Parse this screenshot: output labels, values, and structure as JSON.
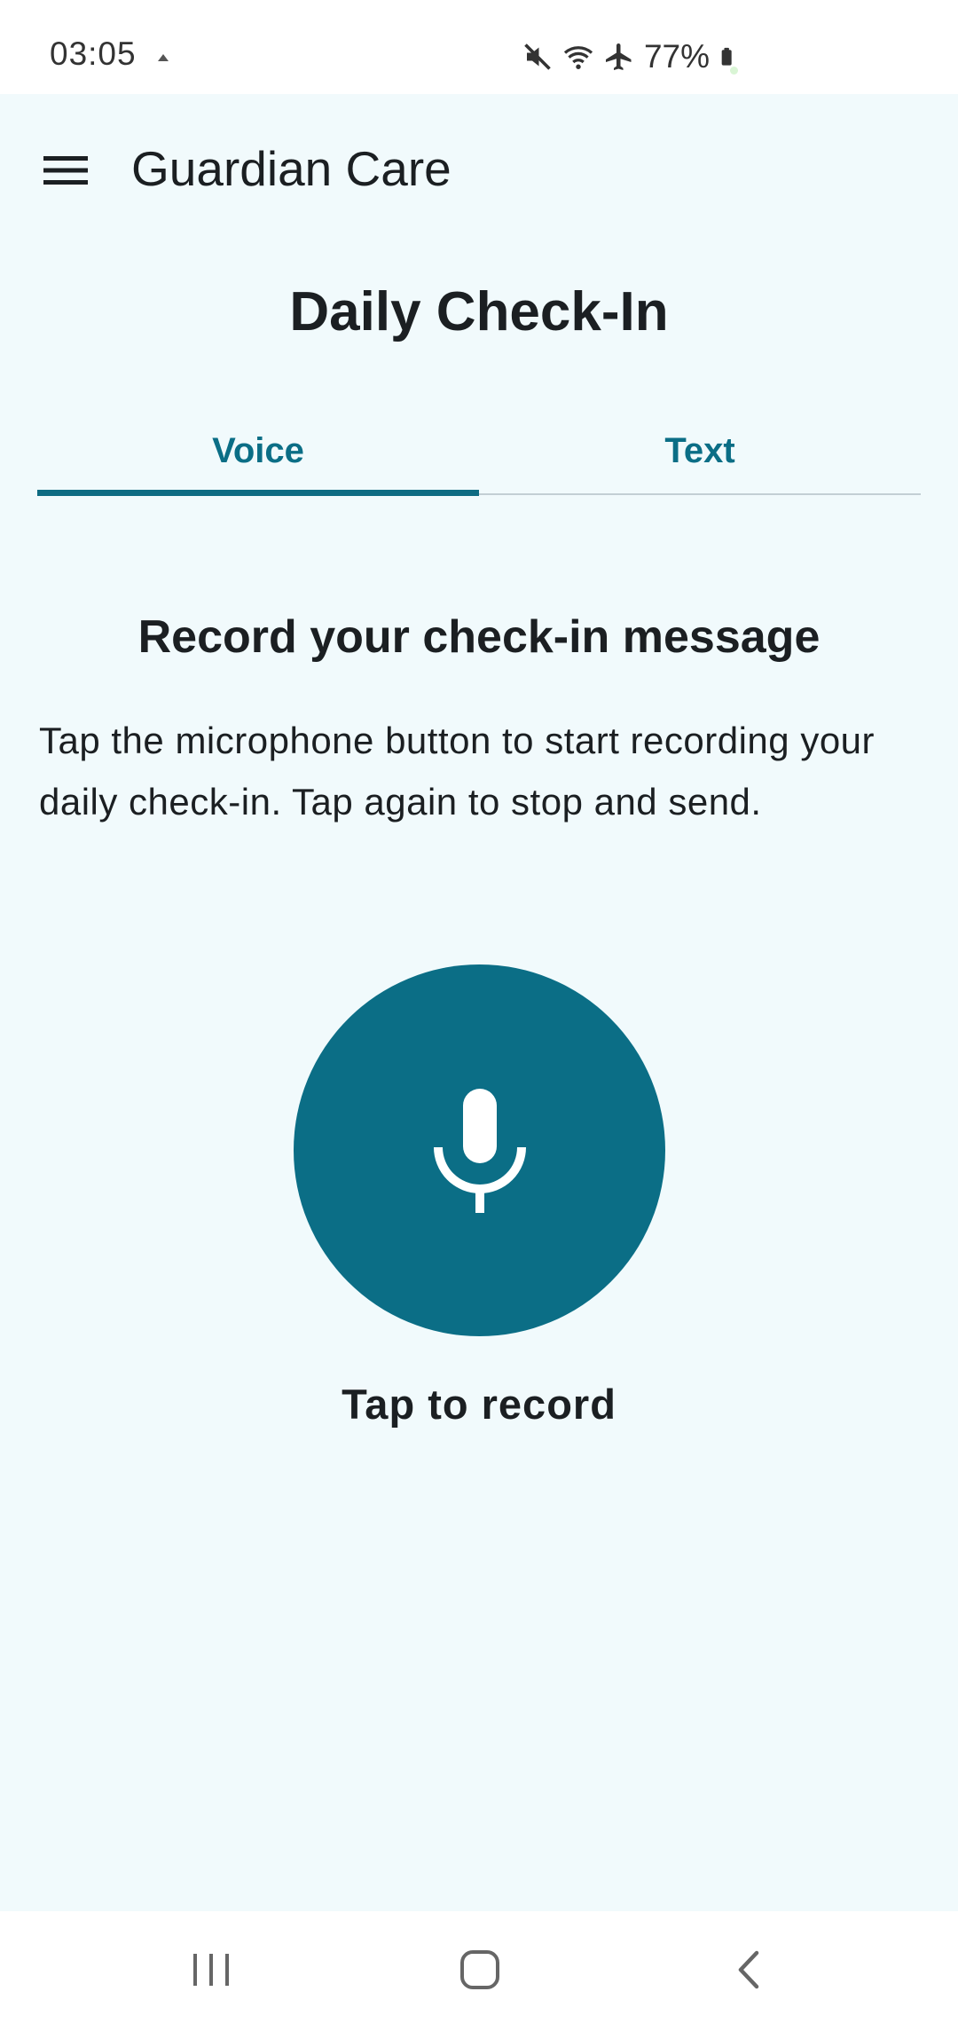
{
  "status_bar": {
    "time": "03:05",
    "battery_percent": "77%",
    "icons": [
      "notification-dot-icon",
      "mute-icon",
      "wifi-icon",
      "airplane-icon",
      "battery-icon"
    ]
  },
  "app_bar": {
    "title": "Guardian Care",
    "menu_icon": "hamburger-menu-icon"
  },
  "page": {
    "title": "Daily Check-In"
  },
  "tabs": [
    {
      "label": "Voice",
      "selected": true
    },
    {
      "label": "Text",
      "selected": false
    }
  ],
  "voice": {
    "heading": "Record your check-in message",
    "instructions": "Tap the microphone button to start recording your daily check-in. Tap again to stop and send.",
    "mic_icon": "microphone-icon",
    "caption": "Tap to record"
  },
  "nav_bar": {
    "icons": [
      "recents-icon",
      "home-icon",
      "back-icon"
    ]
  },
  "colors": {
    "accent": "#0b6e86",
    "background": "#f1fafc",
    "text": "#1b1f22"
  }
}
